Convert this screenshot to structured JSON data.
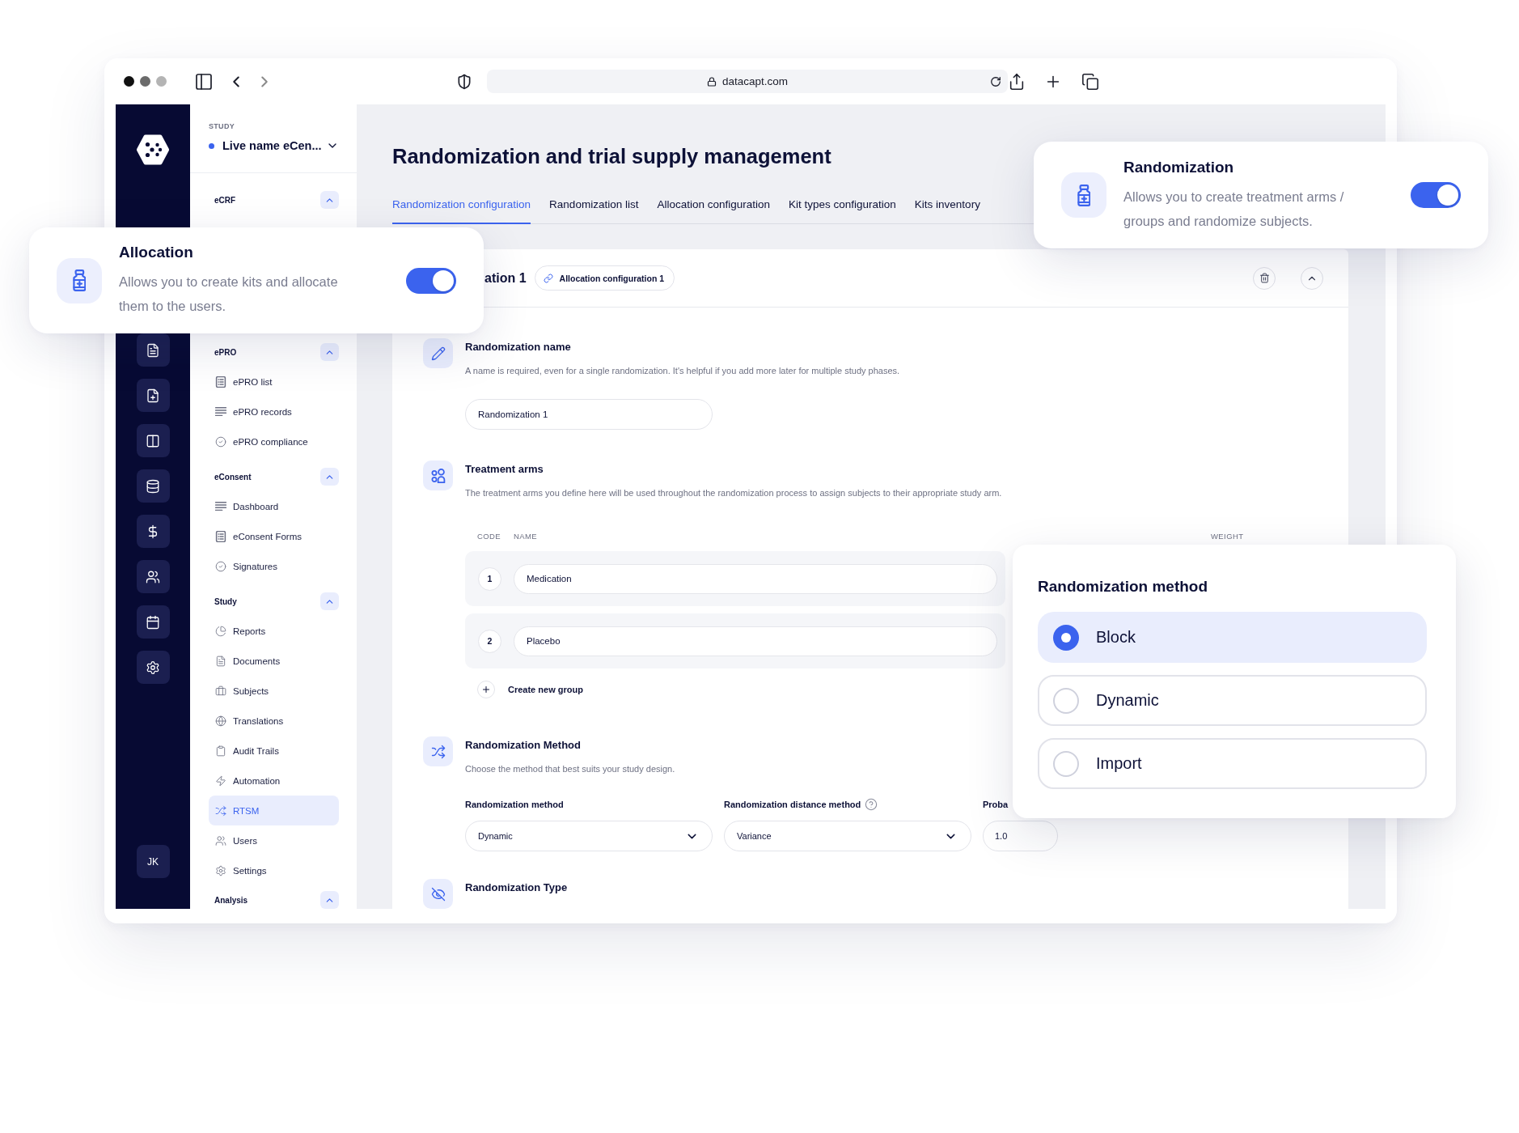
{
  "browser": {
    "url": "datacapt.com"
  },
  "rail": {
    "avatar": "JK"
  },
  "sidebar": {
    "study_label": "STUDY",
    "study_name": "Live name eCen...",
    "sections": [
      {
        "label": "eCRF",
        "expanded": true
      },
      {
        "label": "ePRO",
        "expanded": true,
        "items": [
          {
            "label": "ePRO list",
            "selected": false
          },
          {
            "label": "ePRO records",
            "selected": false
          },
          {
            "label": "ePRO compliance",
            "selected": false
          }
        ]
      },
      {
        "label": "eConsent",
        "expanded": true,
        "items": [
          {
            "label": "Dashboard",
            "selected": false
          },
          {
            "label": "eConsent Forms",
            "selected": false
          },
          {
            "label": "Signatures",
            "selected": false
          }
        ]
      },
      {
        "label": "Study",
        "expanded": true,
        "items": [
          {
            "label": "Reports",
            "selected": false
          },
          {
            "label": "Documents",
            "selected": false
          },
          {
            "label": "Subjects",
            "selected": false
          },
          {
            "label": "Translations",
            "selected": false
          },
          {
            "label": "Audit Trails",
            "selected": false
          },
          {
            "label": "Automation",
            "selected": false
          },
          {
            "label": "RTSM",
            "selected": true
          },
          {
            "label": "Users",
            "selected": false
          },
          {
            "label": "Settings",
            "selected": false
          }
        ]
      },
      {
        "label": "Analysis",
        "expanded": true
      }
    ]
  },
  "page": {
    "title": "Randomization and trial supply management",
    "tabs": [
      {
        "label": "Randomization configuration",
        "selected": true
      },
      {
        "label": "Randomization list",
        "selected": false
      },
      {
        "label": "Allocation configuration",
        "selected": false
      },
      {
        "label": "Kit types configuration",
        "selected": false
      },
      {
        "label": "Kits inventory",
        "selected": false
      }
    ]
  },
  "config_card": {
    "title": "ation 1",
    "link_chip": "Allocation configuration 1",
    "sections": [
      {
        "kind": "name",
        "title": "Randomization name",
        "description": "A name is required, even for a single randomization. It's helpful if you add more later for multiple study phases.",
        "input_value": "Randomization 1"
      },
      {
        "kind": "arms",
        "title": "Treatment arms",
        "description": "The treatment arms you define here will be used throughout the randomization process to assign subjects to their appropriate study arm.",
        "columns": [
          "CODE",
          "NAME",
          "WEIGHT"
        ],
        "rows": [
          {
            "code": "1",
            "name": "Medication"
          },
          {
            "code": "2",
            "name": "Placebo"
          }
        ],
        "add_label": "Create new group"
      },
      {
        "kind": "method",
        "title": "Randomization Method",
        "description": "Choose the method that best suits your study design.",
        "fields": [
          {
            "kind": "select",
            "label": "Randomization method",
            "value": "Dynamic",
            "help": false
          },
          {
            "kind": "select",
            "label": "Randomization distance method",
            "value": "Variance",
            "help": true
          },
          {
            "kind": "input",
            "label": "Proba",
            "value": "1.0",
            "help": false
          }
        ]
      },
      {
        "kind": "type",
        "title": "Randomization Type"
      }
    ]
  },
  "allocation_card": {
    "title": "Allocation",
    "description": "Allows you to create kits and allocate them to the users.",
    "on": true
  },
  "randomization_card": {
    "title": "Randomization",
    "description": "Allows you to create treatment arms / groups and randomize subjects.",
    "on": true
  },
  "method_card": {
    "title": "Randomization method",
    "options": [
      {
        "label": "Block",
        "selected": true
      },
      {
        "label": "Dynamic",
        "selected": false
      },
      {
        "label": "Import",
        "selected": false
      }
    ]
  }
}
